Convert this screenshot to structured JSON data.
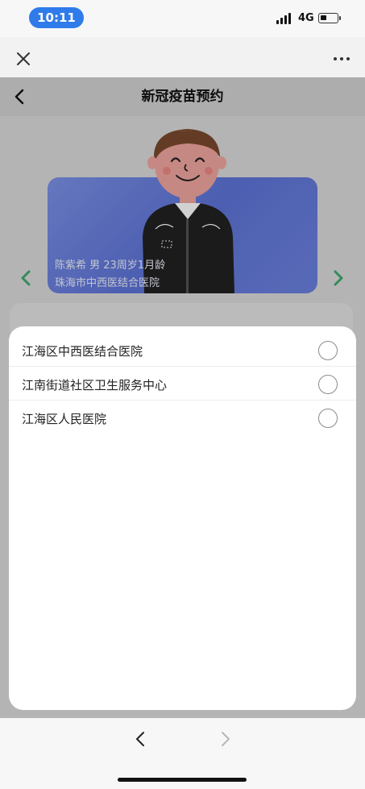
{
  "status_bar": {
    "time": "10:11",
    "network": "4G",
    "signal_icon": "signal-bars-icon",
    "battery_icon": "battery-icon",
    "battery_level": 0.25,
    "time_pill_color": "#2f7bea"
  },
  "top_bar": {
    "close_icon": "close-icon",
    "more_icon": "more-dots-icon"
  },
  "page": {
    "title": "新冠疫苗预约",
    "back_icon": "chevron-left-icon",
    "card": {
      "line1": "陈紫希 男 23周岁1月龄",
      "line2": "珠海市中西医结合医院",
      "accent_color": "#6c82e0"
    },
    "carousel_arrow_color": "#3daa6b"
  },
  "sheet": {
    "options": [
      {
        "label": "江海区中西医结合医院",
        "selected": false
      },
      {
        "label": "江南街道社区卫生服务中心",
        "selected": false
      },
      {
        "label": "江海区人民医院",
        "selected": false
      }
    ]
  },
  "bottom_bar": {
    "back_icon": "chevron-left-icon",
    "forward_icon": "chevron-right-icon"
  }
}
